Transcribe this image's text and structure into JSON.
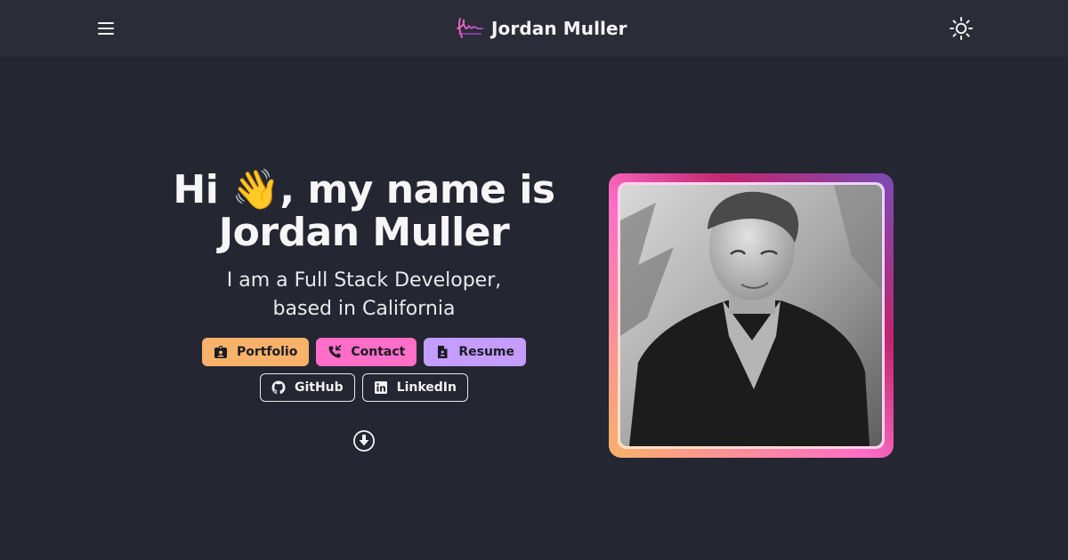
{
  "header": {
    "brand_name": "Jordan Muller",
    "menu_icon": "menu-icon",
    "logo_icon": "signature-logo-icon",
    "theme_icon": "sun-icon"
  },
  "hero": {
    "headline_prefix": "Hi",
    "wave_emoji": "👋",
    "headline_rest": ", my name is",
    "headline_name": "Jordan Muller",
    "subtitle_line1": "I am a Full Stack Developer,",
    "subtitle_line2": "based in California",
    "buttons": [
      {
        "label": "Portfolio",
        "icon": "id-badge-icon",
        "color": "#f8b26a"
      },
      {
        "label": "Contact",
        "icon": "phone-icon",
        "color": "#ff6ec7"
      },
      {
        "label": "Resume",
        "icon": "document-icon",
        "color": "#c59cff"
      }
    ],
    "social": [
      {
        "label": "GitHub",
        "icon": "github-icon"
      },
      {
        "label": "LinkedIn",
        "icon": "linkedin-icon"
      }
    ],
    "scroll_icon": "arrow-down-circle-icon"
  },
  "colors": {
    "background": "#242631",
    "header": "#2a2c38",
    "gradient": [
      "#f8b26a",
      "#ff6ec7",
      "#c1266e",
      "#7a4bb6"
    ]
  }
}
